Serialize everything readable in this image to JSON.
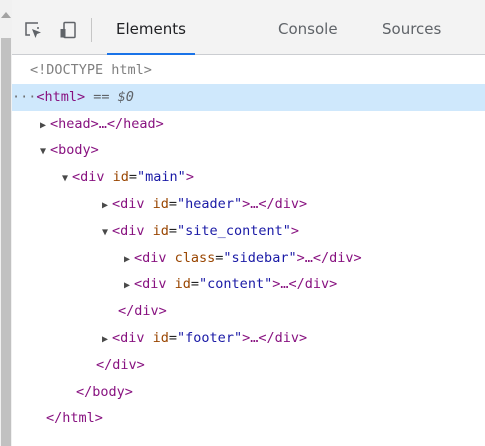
{
  "toolbar": {
    "tabs": [
      {
        "label": "Elements"
      },
      {
        "label": "Console"
      },
      {
        "label": "Sources"
      }
    ]
  },
  "tree": {
    "doctype": "<!DOCTYPE html>",
    "dots": "···",
    "html_open": "<html>",
    "html_selected_marker": " == $0",
    "head": "<head>…</head>",
    "body_open": "<body>",
    "div_open": "<div ",
    "div_close": "</div>",
    "ellipsis_close_div": ">…</div>",
    "close_bracket": ">",
    "id_attr": "id",
    "class_attr": "class",
    "equals": "=",
    "main_value": "\"main\"",
    "header_value": "\"header\"",
    "site_content_value": "\"site_content\"",
    "sidebar_value": "\"sidebar\"",
    "content_value": "\"content\"",
    "footer_value": "\"footer\"",
    "body_close": "</body>",
    "html_close": "</html>"
  },
  "arrows": {
    "collapsed": "▶",
    "expanded": "▼"
  }
}
